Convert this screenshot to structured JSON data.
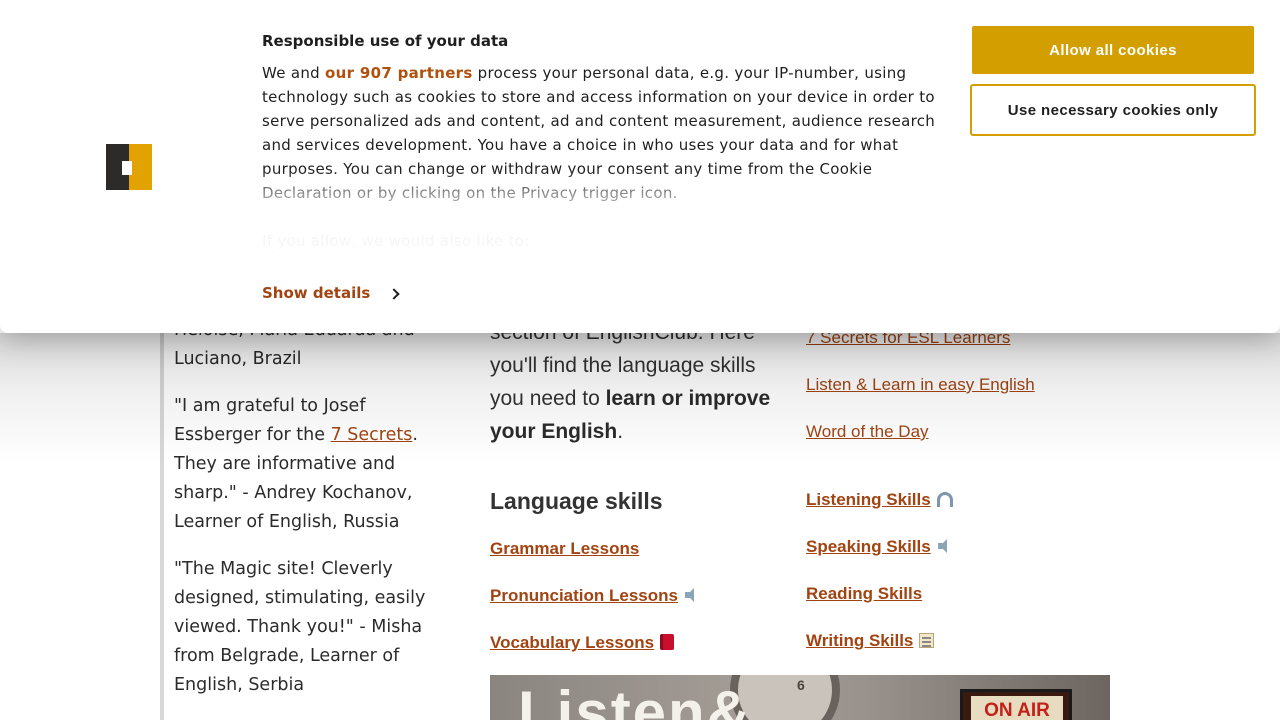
{
  "cookie_dialog": {
    "title": "Responsible use of your data",
    "body_prefix": "We and ",
    "partners_link": "our 907 partners",
    "body_main": " process your personal data, e.g. your IP-number, using technology such as cookies to store and access information on your device in order to serve personalized ads and content, ad and content measurement, audience research and services development. You have a choice in who uses your data and for what purposes. You can change or withdraw your consent any time from the Cookie Declaration or by clicking on the Privacy trigger icon.",
    "faded_text": "If you allow, we would also like to:",
    "show_details": "Show details",
    "allow_all": "Allow all cookies",
    "necessary_only": "Use necessary cookies only",
    "accent_color": "#d39f00",
    "link_color": "#a14412"
  },
  "testimonials": {
    "first_partial": "Heloise, Maria Eduarda and Luciano, Brazil",
    "second_prefix": "\"I am grateful to Josef Essberger for the ",
    "second_link": "7 Secrets",
    "second_suffix": ". They are informative and sharp.\" - Andrey Kochanov, Learner of English, Russia",
    "third": "\"The Magic site! Cleverly designed, stimulating, easily viewed. Thank you!\" - Misha from Belgrade, Learner of English, Serbia"
  },
  "intro": {
    "line_partial": "section of EnglishClub. Here you'll find the language skills you need to ",
    "bold": "learn or improve your English",
    "suffix": "."
  },
  "side_links": {
    "secrets": "7 Secrets for ESL Learners",
    "listen_learn": "Listen & Learn in easy English",
    "word_of_day": "Word of the Day"
  },
  "language_skills": {
    "heading": "Language skills",
    "grammar": "Grammar Lessons",
    "pronunciation": "Pronunciation Lessons",
    "vocabulary": "Vocabulary Lessons",
    "listening": "Listening Skills",
    "speaking": "Speaking Skills",
    "reading": "Reading Skills",
    "writing": "Writing Skills"
  },
  "banner": {
    "word": "Listen&",
    "clock_number": "6",
    "on_air": "ON AIR"
  }
}
